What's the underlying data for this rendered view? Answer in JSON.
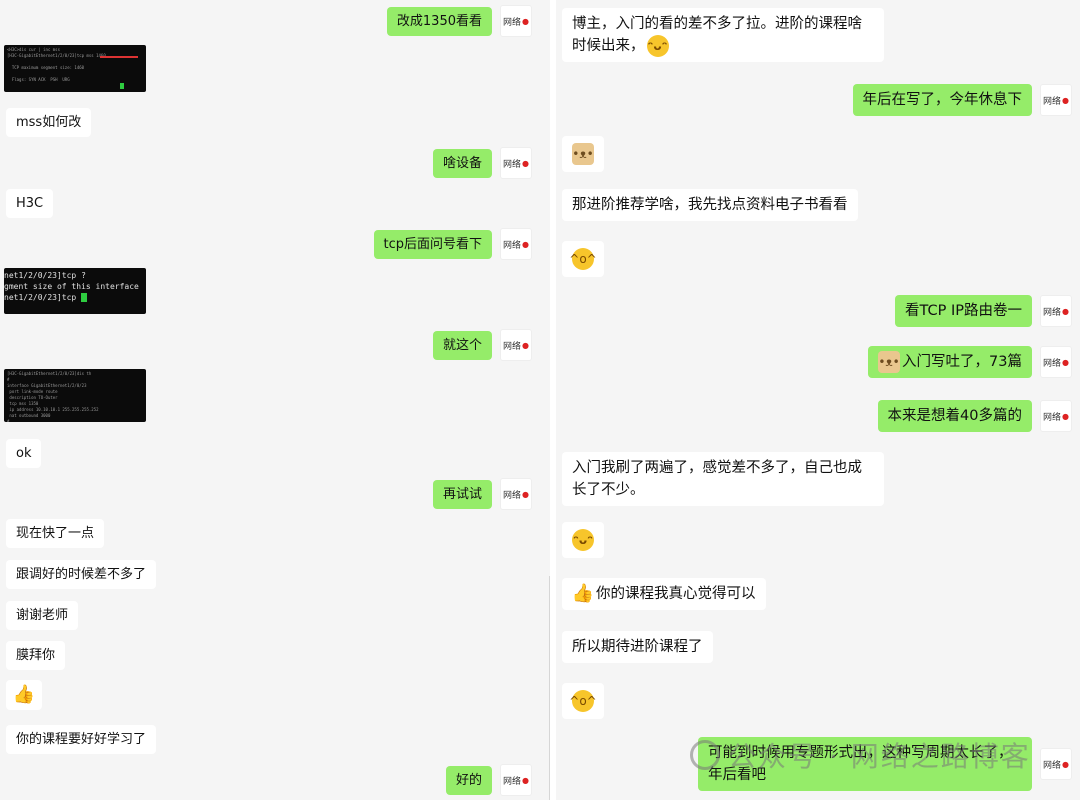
{
  "left": {
    "avatar_label": "网络",
    "messages": [
      {
        "text": "改成1350看看"
      },
      {
        "text": "mss如何改"
      },
      {
        "text": "啥设备"
      },
      {
        "text": "H3C"
      },
      {
        "text": "tcp后面问号看下"
      },
      {
        "text": "就这个"
      },
      {
        "text": "ok"
      },
      {
        "text": "再试试"
      },
      {
        "text": "现在快了一点"
      },
      {
        "text": "跟调好的时候差不多了"
      },
      {
        "text": "谢谢老师"
      },
      {
        "text": "膜拜你"
      },
      {
        "text": "你的课程要好好学习了"
      },
      {
        "text": "好的"
      }
    ],
    "terminal2": {
      "lines": [
        "net1/2/0/23]tcp ?",
        "gment size of this interface",
        "",
        "net1/2/0/23]tcp "
      ]
    }
  },
  "right": {
    "messages": [
      {
        "text": "博主，入门的看的差不多了拉。进阶的课程啥时候出来，"
      },
      {
        "text": "年后在写了，今年休息下"
      },
      {
        "text": "那进阶推荐学啥，我先找点资料电子书看看"
      },
      {
        "text": "看TCP IP路由卷一"
      },
      {
        "text": "入门写吐了，73篇"
      },
      {
        "text": "本来是想着40多篇的"
      },
      {
        "text": "入门我刷了两遍了，感觉差不多了，自己也成长了不少。"
      },
      {
        "text": "你的课程我真心觉得可以"
      },
      {
        "text": "所以期待进阶课程了"
      },
      {
        "text": "可能到时候用专题形式出，这种写周期太长了，年后看吧"
      }
    ]
  },
  "watermark": {
    "text": "公众号 · 网络之路博客"
  },
  "colors": {
    "outgoing": "#95ec69",
    "incoming": "#ffffff",
    "background": "#f5f5f5"
  }
}
